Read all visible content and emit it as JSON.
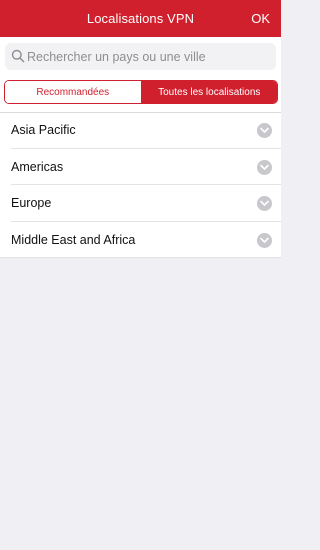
{
  "header": {
    "title": "Localisations VPN",
    "ok_label": "OK"
  },
  "search": {
    "placeholder": "Rechercher un pays ou une ville",
    "value": ""
  },
  "tabs": [
    {
      "label": "Recommandées",
      "selected": false
    },
    {
      "label": "Toutes les localisations",
      "selected": true
    }
  ],
  "regions": [
    {
      "label": "Asia Pacific",
      "icon": "chevron-down-icon"
    },
    {
      "label": "Americas",
      "icon": "chevron-down-icon"
    },
    {
      "label": "Europe",
      "icon": "chevron-down-icon"
    },
    {
      "label": "Middle East and Africa",
      "icon": "chevron-down-icon"
    }
  ],
  "colors": {
    "accent": "#d0202e",
    "background": "#f0eff4",
    "chevron": "#c7c7cc"
  }
}
